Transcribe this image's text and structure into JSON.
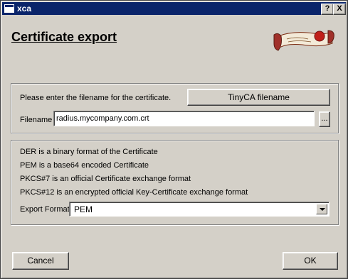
{
  "window": {
    "title": "xca",
    "help_btn": "?",
    "close_btn": "X"
  },
  "header": {
    "title": "Certificate export"
  },
  "file_section": {
    "prompt": "Please enter the filename for the certificate.",
    "tinyca_button": "TinyCA filename",
    "filename_label": "Filename",
    "filename_value": "radius.mycompany.com.crt",
    "browse_button": "..."
  },
  "format_section": {
    "info_lines": [
      "DER is a binary format of the Certificate",
      "PEM is a base64 encoded Certificate",
      "PKCS#7 is an official Certificate exchange format",
      "PKCS#12 is an encrypted official Key-Certificate exchange format"
    ],
    "format_label": "Export Format",
    "format_value": "PEM"
  },
  "footer": {
    "cancel": "Cancel",
    "ok": "OK"
  }
}
